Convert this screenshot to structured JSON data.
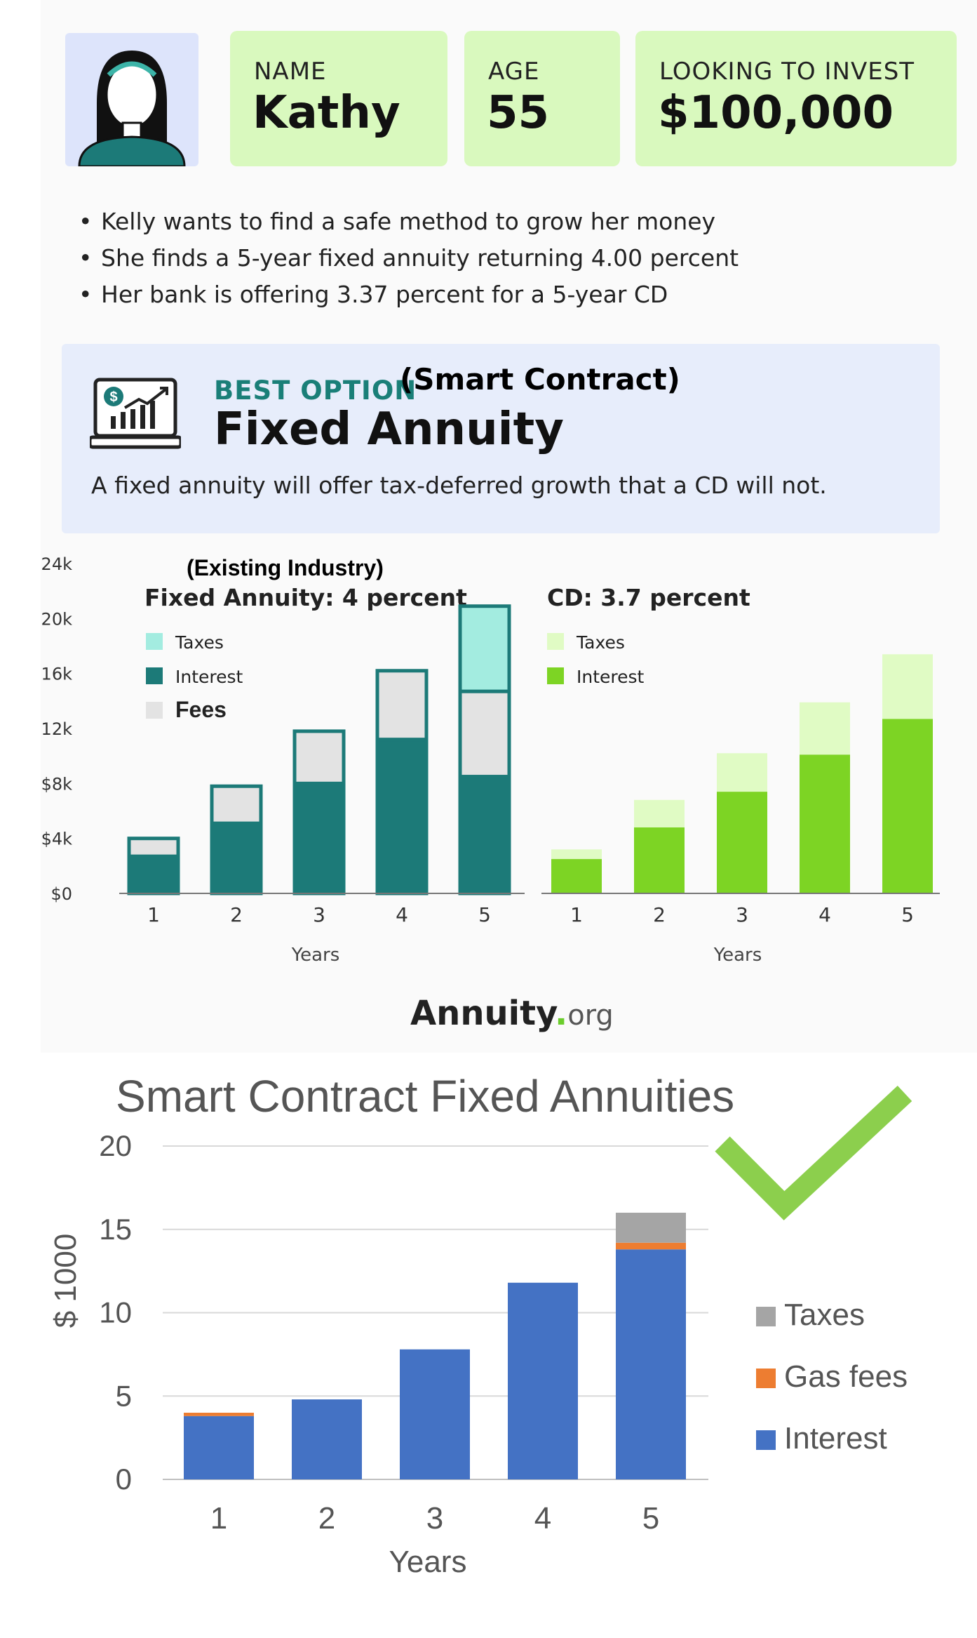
{
  "profile": {
    "name_label": "NAME",
    "name_value": "Kathy",
    "age_label": "AGE",
    "age_value": "55",
    "invest_label": "LOOKING TO INVEST",
    "invest_value": "$100,000"
  },
  "bullets": [
    "Kelly wants to find a safe method to grow her money",
    "She finds a 5-year fixed annuity returning 4.00 percent",
    "Her bank is offering 3.37 percent for a 5-year CD"
  ],
  "best_option": {
    "label": "BEST OPTION",
    "tag": "(Smart Contract)",
    "title": "Fixed Annuity",
    "description": "A fixed annuity will offer tax-deferred growth that a CD will not."
  },
  "brand": {
    "name": "Annuity",
    "dot": ".",
    "tld": "org"
  },
  "colors": {
    "teal": "#1c7a78",
    "teal_light": "#a3ece0",
    "fees_gray": "#e3e3e3",
    "green": "#7dd424",
    "green_light": "#e0fbc4",
    "blue": "#4472c4",
    "orange": "#ed7d31",
    "gray": "#a5a5a5",
    "check": "#8ccf4d"
  },
  "chart_data": [
    {
      "type": "bar",
      "stacked": true,
      "annotation": "(Existing Industry)",
      "title": "Fixed Annuity: 4 percent",
      "categories": [
        "1",
        "2",
        "3",
        "4",
        "5"
      ],
      "xlabel": "Years",
      "yticks": [
        "$0",
        "$4k",
        "$8k",
        "$12k",
        "$16k",
        "$20k",
        "$24k"
      ],
      "ylim": [
        0,
        24000
      ],
      "series": [
        {
          "name": "Interest",
          "color": "#1c7a78",
          "values": [
            2700,
            5100,
            8000,
            11200,
            8500
          ]
        },
        {
          "name": "Fees",
          "color": "#e3e3e3",
          "values": [
            1300,
            2700,
            3800,
            5000,
            6200
          ]
        },
        {
          "name": "Taxes",
          "color": "#a3ece0",
          "values": [
            0,
            0,
            0,
            0,
            6200
          ]
        }
      ],
      "legend": [
        "Taxes",
        "Interest",
        "Fees"
      ]
    },
    {
      "type": "bar",
      "stacked": true,
      "title": "CD: 3.7 percent",
      "categories": [
        "1",
        "2",
        "3",
        "4",
        "5"
      ],
      "xlabel": "Years",
      "ylim": [
        0,
        24000
      ],
      "series": [
        {
          "name": "Interest",
          "color": "#7dd424",
          "values": [
            2500,
            4800,
            7400,
            10100,
            12700
          ]
        },
        {
          "name": "Taxes",
          "color": "#e0fbc4",
          "values": [
            700,
            2000,
            2800,
            3800,
            4700
          ]
        }
      ],
      "legend": [
        "Taxes",
        "Interest"
      ]
    },
    {
      "type": "bar",
      "stacked": true,
      "title": "Smart Contract Fixed Annuities",
      "categories": [
        "1",
        "2",
        "3",
        "4",
        "5"
      ],
      "xlabel": "Years",
      "ylabel": "$ 1000",
      "ylim": [
        0,
        20
      ],
      "yticks": [
        "0",
        "5",
        "10",
        "15",
        "20"
      ],
      "grid": true,
      "series": [
        {
          "name": "Interest",
          "color": "#4472c4",
          "values": [
            3.8,
            4.8,
            7.8,
            11.8,
            13.8
          ]
        },
        {
          "name": "Gas fees",
          "color": "#ed7d31",
          "values": [
            0.2,
            0,
            0,
            0,
            0.4
          ]
        },
        {
          "name": "Taxes",
          "color": "#a5a5a5",
          "values": [
            0,
            0,
            0,
            0,
            1.8
          ]
        }
      ],
      "legend": [
        "Taxes",
        "Gas fees",
        "Interest"
      ],
      "legend_position": "right"
    }
  ]
}
